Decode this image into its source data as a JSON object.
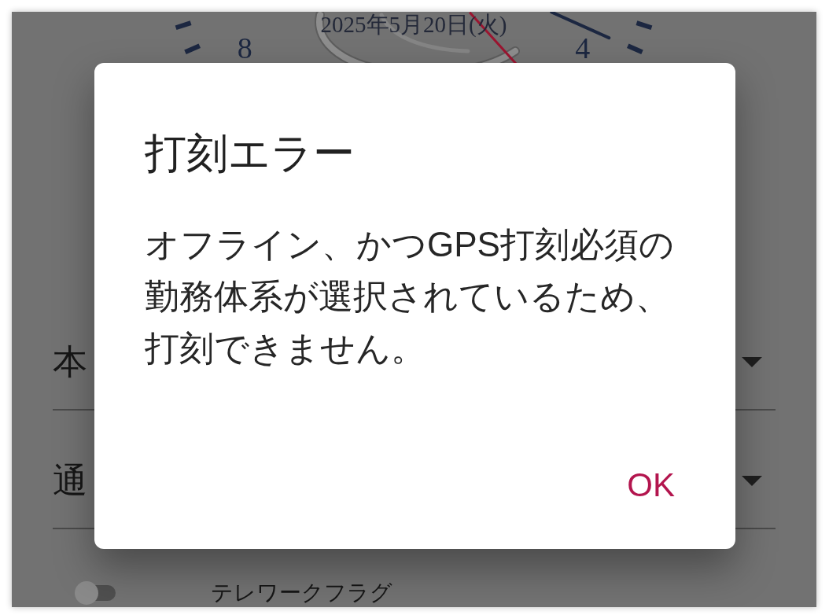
{
  "clock": {
    "date": "2025年5月20日(火)",
    "numerals": [
      "8",
      "4"
    ]
  },
  "dropdowns": [
    {
      "value": "本"
    },
    {
      "value": "通"
    }
  ],
  "toggle": {
    "label": "テレワークフラグ",
    "on": false
  },
  "dialog": {
    "title": "打刻エラー",
    "message": "オフライン、かつGPS打刻必須の勤務体系が選択されているため、打刻できません。",
    "buttons": [
      "OK"
    ]
  }
}
